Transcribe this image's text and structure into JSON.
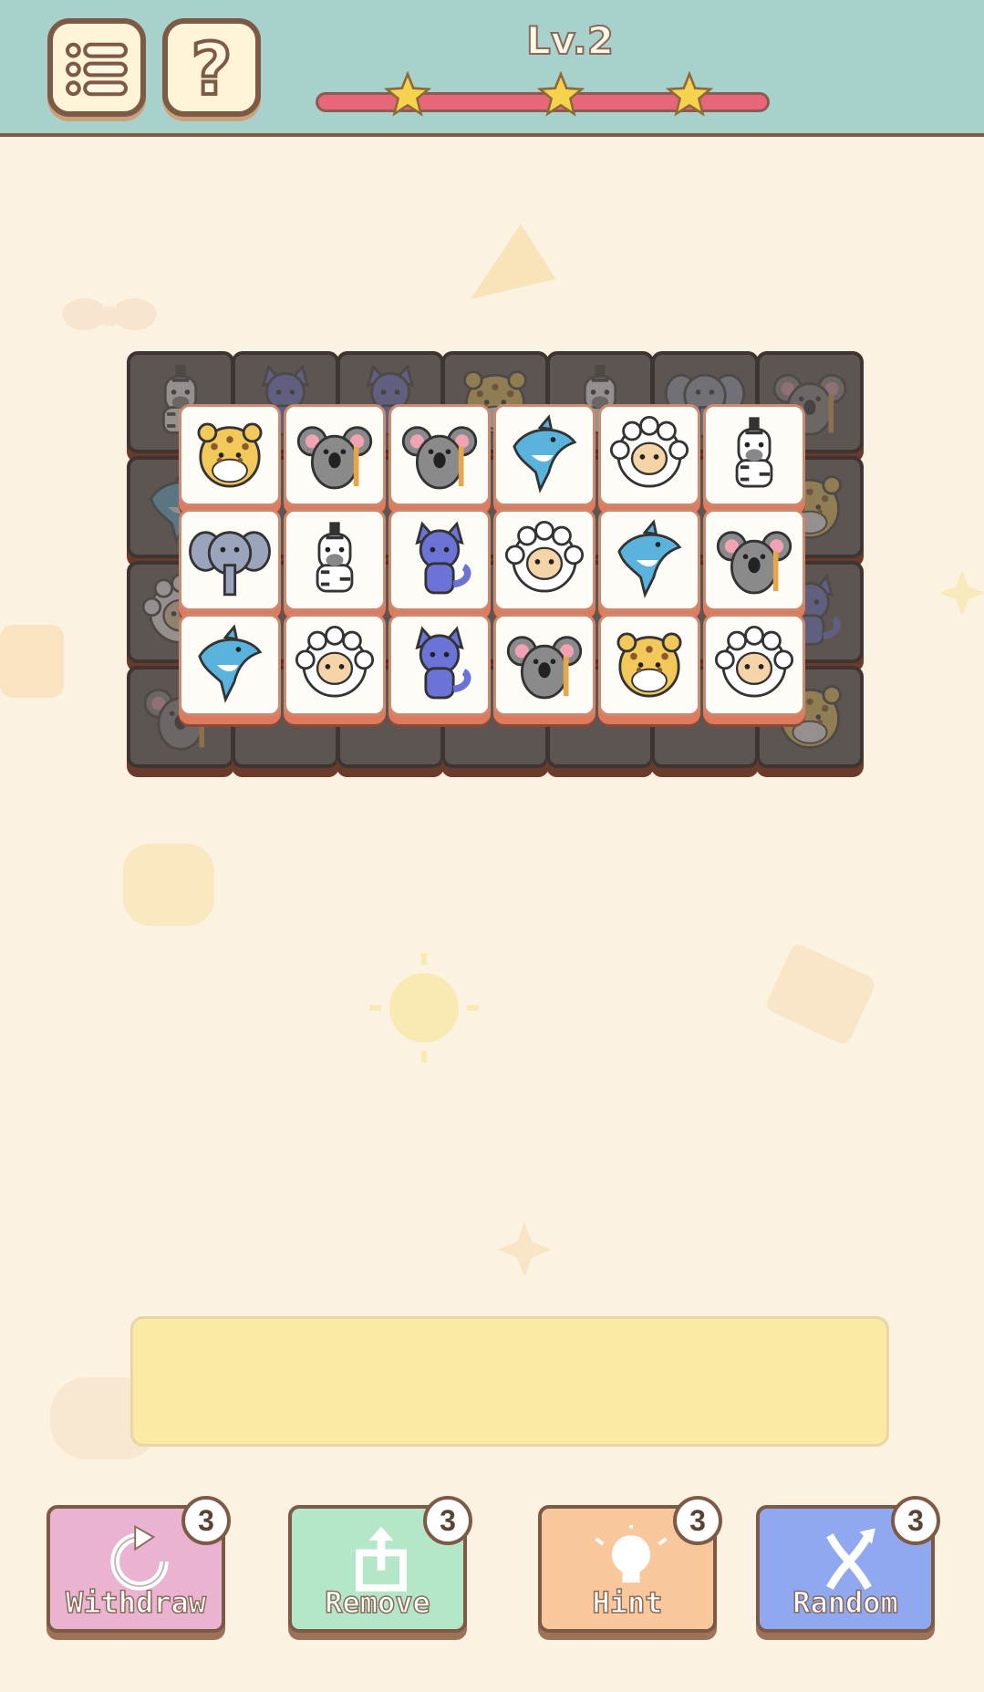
{
  "header": {
    "level_label": "Lv.2",
    "progress_stars": 3,
    "colors": {
      "bar": "#e8667a",
      "bg": "#a9d1cc",
      "star": "#f6d24d"
    }
  },
  "menu_button": {
    "icon": "list-icon"
  },
  "help_button": {
    "icon": "question-icon",
    "label": "?"
  },
  "board": {
    "bottom_layer": [
      [
        "zebra",
        "cat",
        "cat",
        "leopard",
        "zebra",
        "elephant",
        "koala"
      ],
      [
        "dolphin",
        "",
        "",
        "",
        "",
        "",
        "leopard"
      ],
      [
        "sheep",
        "",
        "",
        "",
        "",
        "",
        "cat"
      ],
      [
        "koala",
        "",
        "",
        "",
        "",
        "",
        "leopard"
      ]
    ],
    "top_layer": [
      [
        "leopard",
        "koala",
        "koala",
        "dolphin",
        "sheep",
        "zebra"
      ],
      [
        "elephant",
        "zebra",
        "cat",
        "sheep",
        "dolphin",
        "koala"
      ],
      [
        "dolphin",
        "sheep",
        "cat",
        "koala",
        "leopard",
        "sheep"
      ]
    ]
  },
  "slot_tray": {
    "slots": []
  },
  "powerups": [
    {
      "label": "Withdraw",
      "count": "3",
      "icon": "undo-icon",
      "color": "#eab3cf"
    },
    {
      "label": "Remove",
      "count": "3",
      "icon": "remove-icon",
      "color": "#b4e6c8"
    },
    {
      "label": "Hint",
      "count": "3",
      "icon": "bulb-icon",
      "color": "#f8c89c"
    },
    {
      "label": "Random",
      "count": "3",
      "icon": "shuffle-icon",
      "color": "#8fa8f0"
    }
  ]
}
